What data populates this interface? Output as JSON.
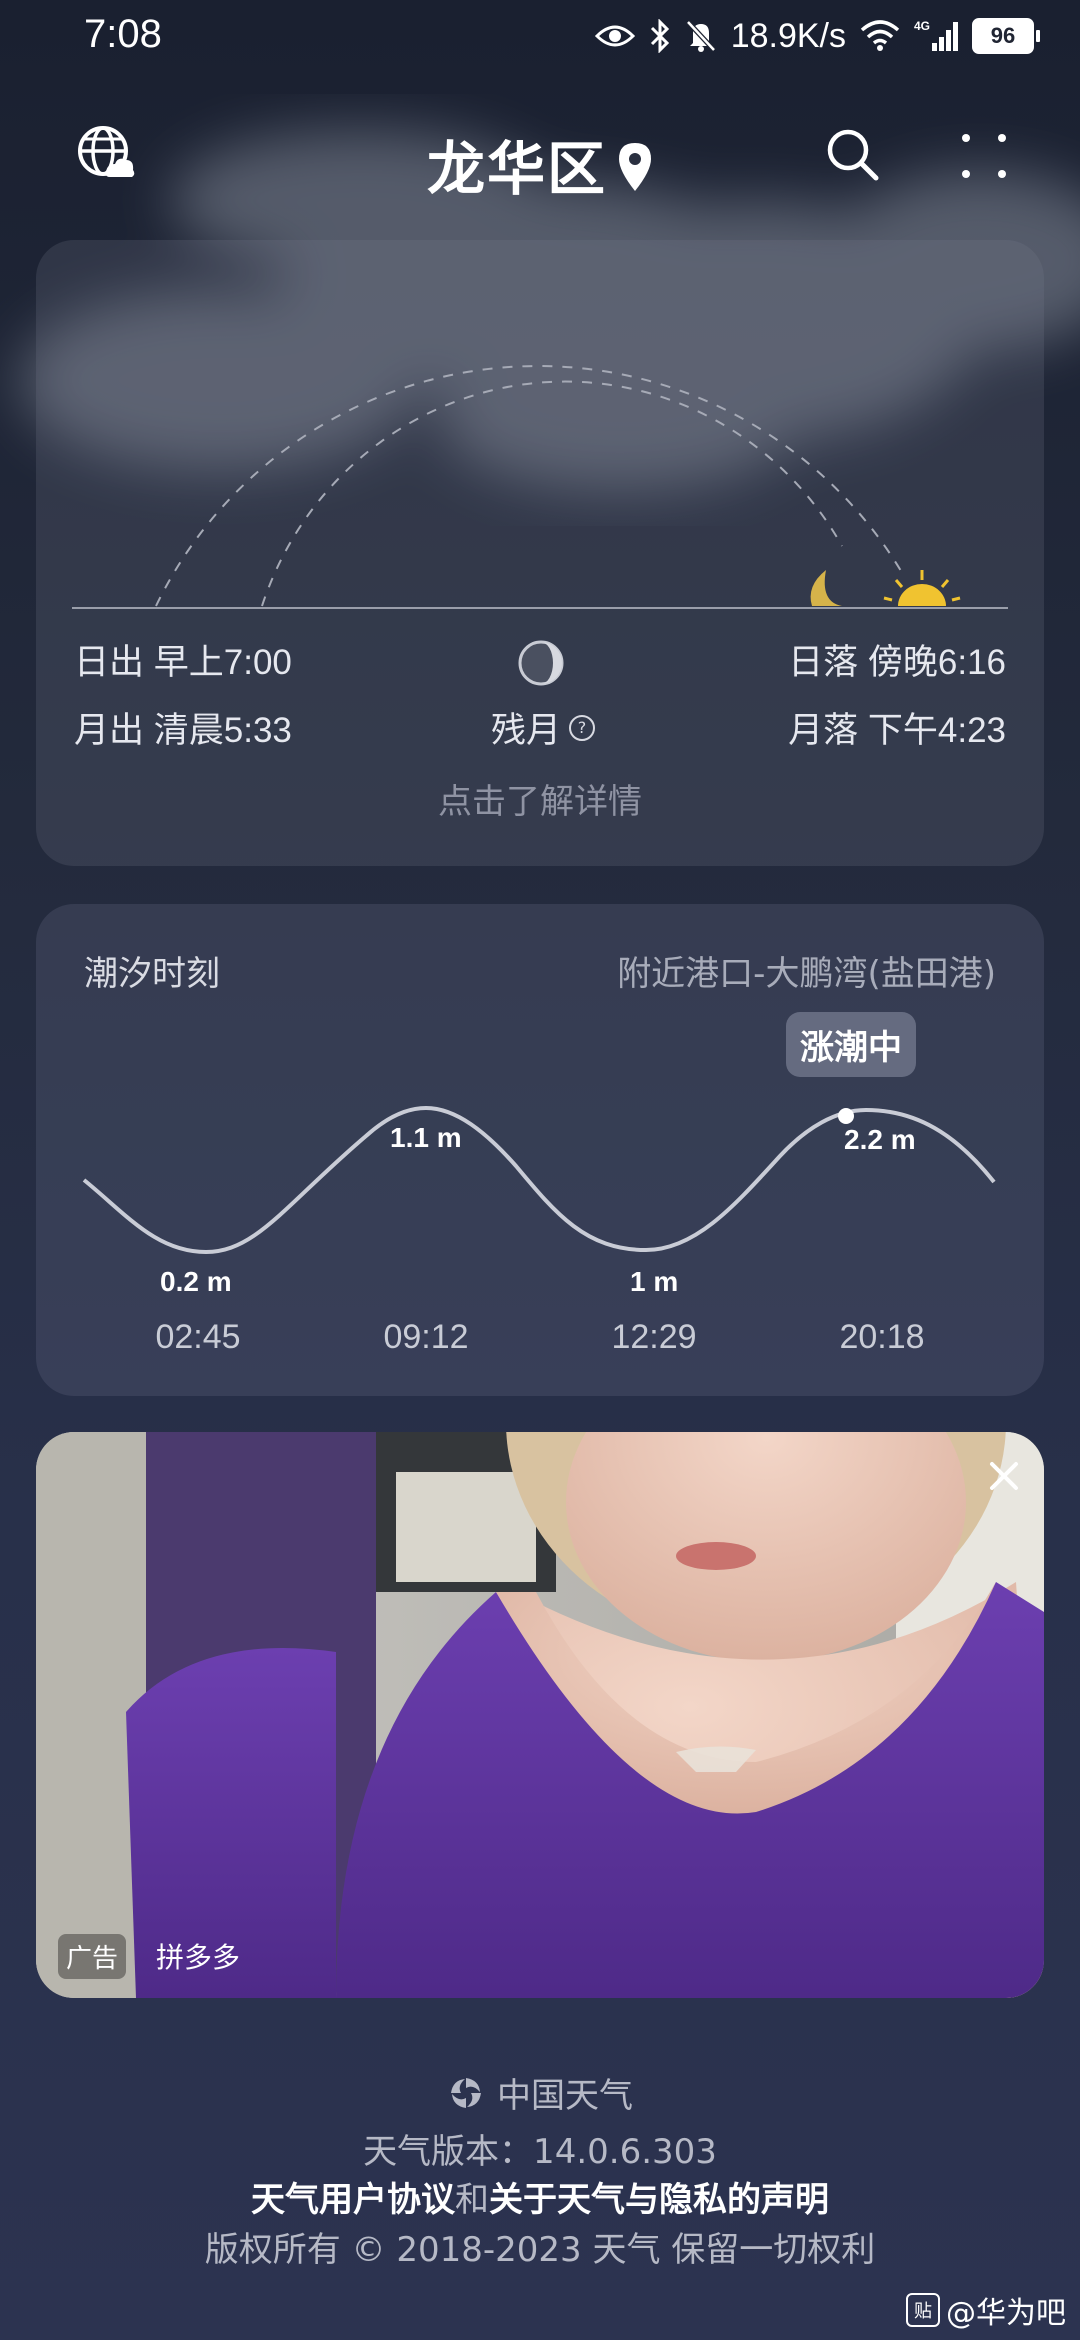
{
  "status_bar": {
    "time": "7:08",
    "net_speed": "18.9K/s",
    "network_type": "4G",
    "battery": "96"
  },
  "header": {
    "title": "龙华区"
  },
  "sun_moon": {
    "sunrise_label": "日出",
    "sunrise_time": "早上7:00",
    "sunset_label": "日落",
    "sunset_time": "傍晚6:16",
    "moonrise_label": "月出",
    "moonrise_time": "清晨5:33",
    "moonset_label": "月落",
    "moonset_time": "下午4:23",
    "moon_phase": "残月",
    "details_link": "点击了解详情"
  },
  "tide": {
    "title": "潮汐时刻",
    "port": "附近港口-大鹏湾(盐田港)",
    "status_badge": "涨潮中",
    "heights": [
      "0.2 m",
      "1.1 m",
      "1 m",
      "2.2 m"
    ],
    "times": [
      "02:45",
      "09:12",
      "12:29",
      "20:18"
    ]
  },
  "ad": {
    "tag": "广告",
    "brand": "拼多多"
  },
  "footer": {
    "brand": "中国天气",
    "version": "天气版本：14.0.6.303",
    "user_agreement": "天气用户协议",
    "and": "和",
    "privacy": "关于天气与隐私的声明",
    "copyright": "版权所有 © 2018-2023 天气 保留一切权利"
  },
  "watermark": {
    "icon": "贴",
    "text": "@华为吧"
  }
}
